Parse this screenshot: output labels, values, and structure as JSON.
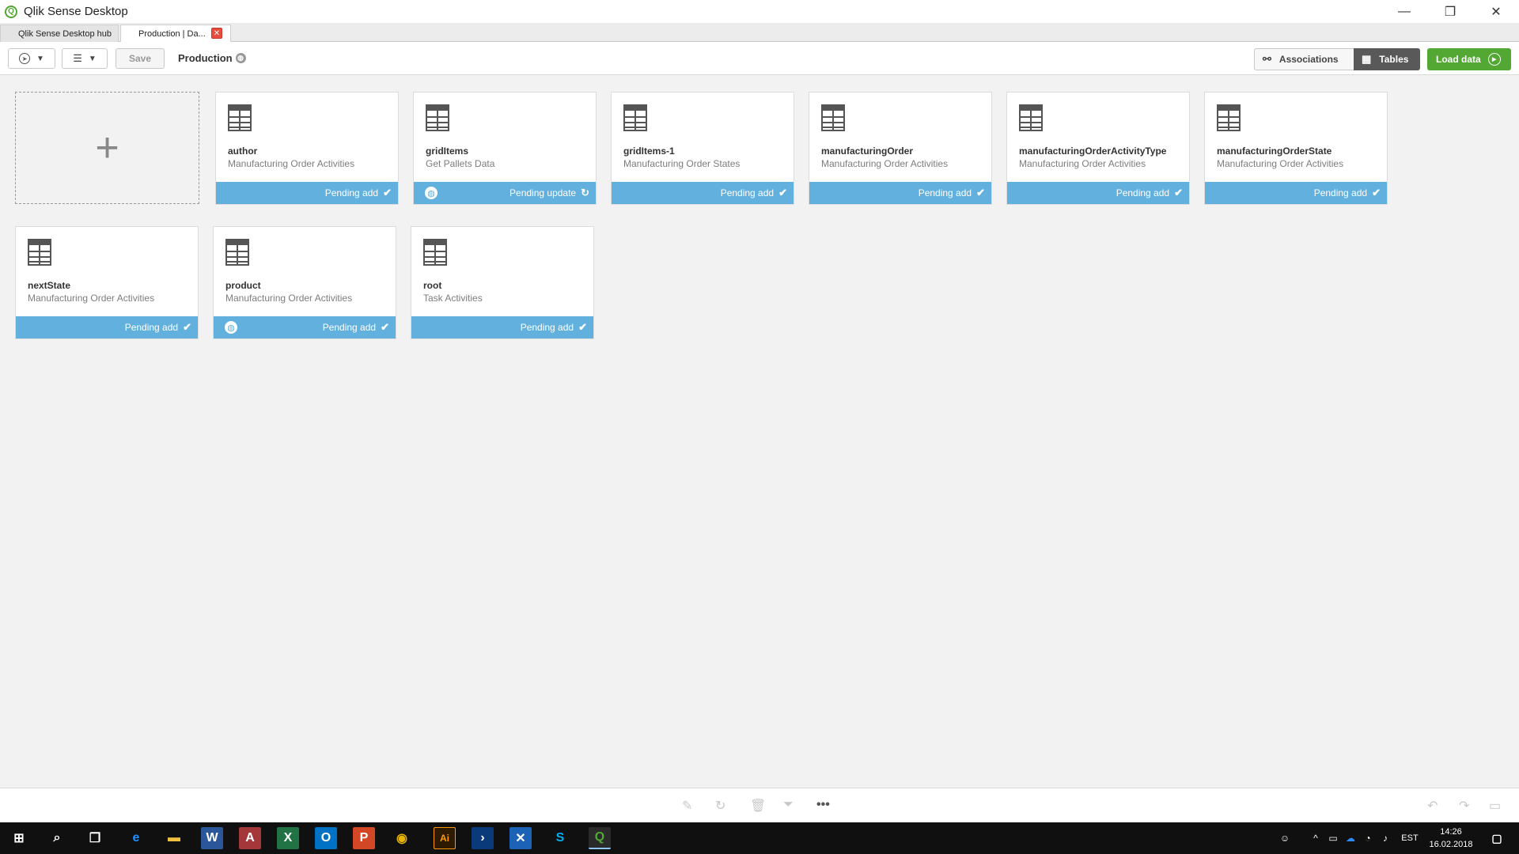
{
  "window": {
    "title": "Qlik Sense Desktop",
    "controls": [
      "—",
      "❐",
      "✕"
    ]
  },
  "tabs": [
    {
      "label": "Qlik Sense Desktop hub"
    },
    {
      "label": "Production | Da..."
    }
  ],
  "toolbar": {
    "save_label": "Save",
    "app_name": "Production",
    "associations_label": "Associations",
    "tables_label": "Tables",
    "load_data_label": "Load data"
  },
  "add_tile": {
    "symbol": "+"
  },
  "cards": [
    {
      "name": "author",
      "source": "Manufacturing Order Activities",
      "status": "Pending add",
      "status_icon": "check-icon",
      "globe": false
    },
    {
      "name": "gridItems",
      "source": "Get Pallets Data",
      "status": "Pending update",
      "status_icon": "refresh-icon",
      "globe": true
    },
    {
      "name": "gridItems-1",
      "source": "Manufacturing Order States",
      "status": "Pending add",
      "status_icon": "check-icon",
      "globe": false
    },
    {
      "name": "manufacturingOrder",
      "source": "Manufacturing Order Activities",
      "status": "Pending add",
      "status_icon": "check-icon",
      "globe": false
    },
    {
      "name": "manufacturingOrderActivityType",
      "source": "Manufacturing Order Activities",
      "status": "Pending add",
      "status_icon": "check-icon",
      "globe": false
    },
    {
      "name": "manufacturingOrderState",
      "source": "Manufacturing Order Activities",
      "status": "Pending add",
      "status_icon": "check-icon",
      "globe": false
    },
    {
      "name": "nextState",
      "source": "Manufacturing Order Activities",
      "status": "Pending add",
      "status_icon": "check-icon",
      "globe": false
    },
    {
      "name": "product",
      "source": "Manufacturing Order Activities",
      "status": "Pending add",
      "status_icon": "check-icon",
      "globe": true
    },
    {
      "name": "root",
      "source": "Task Activities",
      "status": "Pending add",
      "status_icon": "check-icon",
      "globe": false
    }
  ],
  "bottombar": {
    "more_label": "•••"
  },
  "taskbar": {
    "language": "EST",
    "time": "14:26",
    "date": "16.02.2018"
  },
  "colors": {
    "status_blue": "#61b0dd",
    "load_green": "#52a832",
    "tables_dark": "#595959"
  }
}
